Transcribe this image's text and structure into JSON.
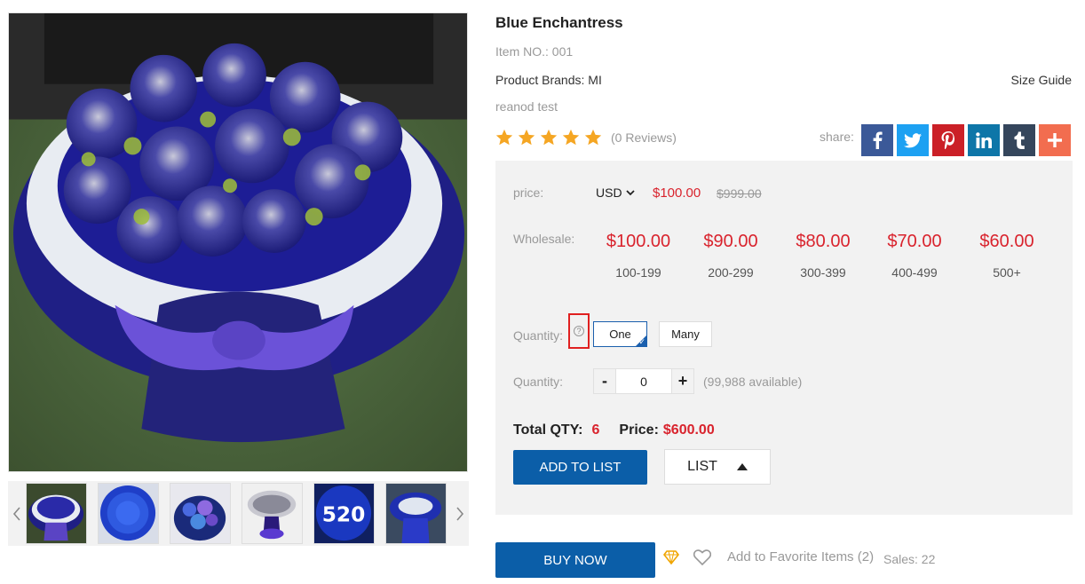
{
  "product": {
    "title": "Blue Enchantress",
    "item_no": "Item NO.: 001",
    "brand": "Product Brands: MI",
    "size_guide": "Size Guide",
    "subtitle": "reanod test",
    "rating": 5,
    "reviews": "(0 Reviews)"
  },
  "gallery": {
    "main_image": "blue-rose-bouquet-photo",
    "prev_icon": "chevron-left-icon",
    "next_icon": "chevron-right-icon",
    "thumbnails": [
      "blue-rose-bouquet-thumb",
      "blue-rose-heart-thumb",
      "blue-rose-box-thumb",
      "silver-rose-bouquet-thumb",
      "520-rose-bouquet-thumb",
      "blue-rose-wrap-thumb"
    ]
  },
  "share": {
    "label": "share:",
    "buttons": [
      {
        "name": "facebook-icon",
        "glyph": "f",
        "color": "#3b5998"
      },
      {
        "name": "twitter-icon",
        "glyph": "t",
        "color": "#1da1f2"
      },
      {
        "name": "pinterest-icon",
        "glyph": "p",
        "color": "#cb2027"
      },
      {
        "name": "linkedin-icon",
        "glyph": "in",
        "color": "#0e76a8"
      },
      {
        "name": "tumblr-icon",
        "glyph": "t",
        "color": "#35465c"
      },
      {
        "name": "more-share-icon",
        "glyph": "+",
        "color": "#f26d4f"
      }
    ]
  },
  "pricing": {
    "price_label": "price:",
    "currency": "USD",
    "price": "$100.00",
    "original_price": "$999.00",
    "wholesale_label": "Wholesale:",
    "tiers": [
      {
        "price": "$100.00",
        "range": "100-199"
      },
      {
        "price": "$90.00",
        "range": "200-299"
      },
      {
        "price": "$80.00",
        "range": "300-399"
      },
      {
        "price": "$70.00",
        "range": "400-499"
      },
      {
        "price": "$60.00",
        "range": "500+"
      }
    ]
  },
  "quantity": {
    "mode_label": "Quantity:",
    "help_icon": "?",
    "options": [
      "One",
      "Many"
    ],
    "selected": "One",
    "qty_label": "Quantity:",
    "minus": "-",
    "plus": "+",
    "value": "0",
    "available": "(99,988 available)"
  },
  "totals": {
    "qty_label": "Total QTY:",
    "qty_value": "6",
    "price_label": "Price:",
    "price_value": "$600.00"
  },
  "actions": {
    "add_to_list": "ADD TO LIST",
    "list": "LIST",
    "buy_now": "BUY NOW",
    "favorite": "Add to Favorite Items (2)",
    "sales": "Sales: 22"
  },
  "colors": {
    "accent_blue": "#0b5ea8",
    "price_red": "#d9232d",
    "star": "#f5a623",
    "panel_bg": "#f2f2f2"
  }
}
